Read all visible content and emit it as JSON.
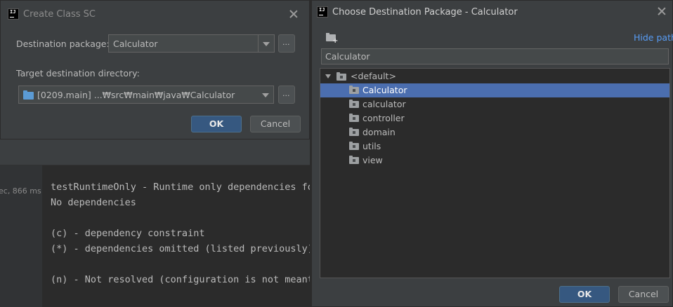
{
  "console": {
    "gutter_text": "ec, 866 ms",
    "lines": [
      "testRuntimeOnly - Runtime only dependencies fo",
      "No dependencies",
      "",
      "(c) - dependency constraint",
      "(*) - dependencies omitted (listed previously)",
      "",
      "(n) - Not resolved (configuration is not meant"
    ]
  },
  "create_class_dialog": {
    "title": "Create Class SC",
    "destination_package_label": "Destination package:",
    "destination_package_value": "Calculator",
    "target_directory_label": "Target destination directory:",
    "target_directory_value": "[0209.main]  ...₩src₩main₩java₩Calculator",
    "browse_label": "...",
    "ok_label": "OK",
    "cancel_label": "Cancel"
  },
  "choose_package_dialog": {
    "title": "Choose Destination Package - Calculator",
    "hide_path_label": "Hide path",
    "path_value": "Calculator",
    "tree": {
      "root": "<default>",
      "items": [
        {
          "label": "Calculator",
          "selected": true
        },
        {
          "label": "calculator",
          "selected": false
        },
        {
          "label": "controller",
          "selected": false
        },
        {
          "label": "domain",
          "selected": false
        },
        {
          "label": "utils",
          "selected": false
        },
        {
          "label": "view",
          "selected": false
        }
      ]
    },
    "ok_label": "OK",
    "cancel_label": "Cancel"
  },
  "colors": {
    "dialog_bg": "#3c3f41",
    "selection": "#4b6eaf",
    "primary_button": "#365880",
    "link": "#589df6",
    "folder_icon": "#5b9bd5"
  }
}
